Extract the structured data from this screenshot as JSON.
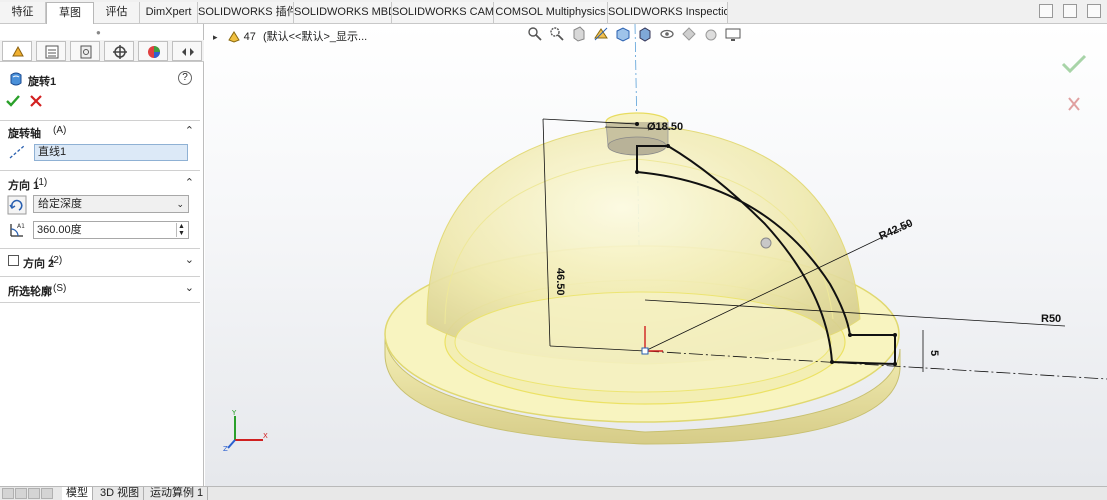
{
  "ribbon": {
    "tabs": [
      "特征",
      "草图",
      "评估",
      "DimXpert",
      "SOLIDWORKS 插件",
      "SOLIDWORKS MBD",
      "SOLIDWORKS CAM",
      "COMSOL Multiphysics",
      "SOLIDWORKS Inspection"
    ],
    "active_tab": "草图"
  },
  "panel": {
    "title": "旋转1",
    "help": "?",
    "axis_section": {
      "title": "旋转轴",
      "shortcut": "(A)",
      "value": "直线1"
    },
    "dir1_section": {
      "title": "方向 1",
      "shortcut": "(1)",
      "type_value": "给定深度",
      "angle_value": "360.00度"
    },
    "dir2_section": {
      "title": "方向 2",
      "shortcut": "(2)",
      "checked": false
    },
    "contour_section": {
      "title": "所选轮廓",
      "shortcut": "(S)"
    }
  },
  "viewport": {
    "breadcrumb_index": "47",
    "breadcrumb_text": "(默认<<默认>_显示..."
  },
  "dimensions": {
    "dia_top": "Ø18.50",
    "radius_inner": "R42.50",
    "radius_outer": "R50",
    "height": "46.50",
    "thickness": "5"
  },
  "bottom_tabs": [
    "模型",
    "3D 视图",
    "运动算例 1"
  ],
  "active_bottom_tab": "模型",
  "colors": {
    "accent": "#1e78d6",
    "ok_green": "#2aa02a",
    "cancel_red": "#d22020",
    "part_yellow": "#f2ec9c"
  }
}
